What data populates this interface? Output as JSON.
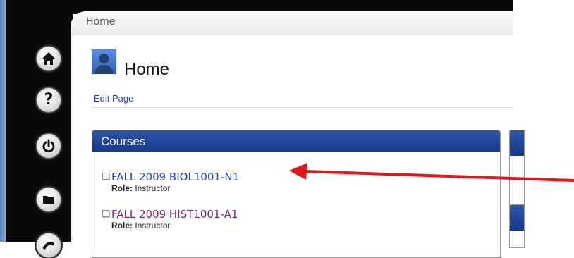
{
  "breadcrumb": {
    "label": "Home"
  },
  "page": {
    "title": "Home",
    "edit_link": "Edit Page"
  },
  "nav": [
    {
      "name": "home",
      "icon": "home-icon",
      "glyph": "⌂"
    },
    {
      "name": "help",
      "icon": "help-icon",
      "glyph": "?"
    },
    {
      "name": "power",
      "icon": "power-icon",
      "glyph": "⏻"
    },
    {
      "name": "folder",
      "icon": "folder-icon",
      "glyph": "▬"
    },
    {
      "name": "globe",
      "icon": "globe-icon",
      "glyph": "◐"
    }
  ],
  "courses": {
    "title": "Courses",
    "items": [
      {
        "name": "FALL 2009 BIOL1001-N1",
        "role_label": "Role:",
        "role": "Instructor",
        "color": "#1d3fb7"
      },
      {
        "name": "FALL 2009 HIST1001-A1",
        "role_label": "Role:",
        "role": "Instructor",
        "color": "#7a1f7a"
      }
    ]
  },
  "colors": {
    "header_blue": "#1f449a",
    "link_blue": "#1d3fb7",
    "visited_purple": "#7a1f7a",
    "arrow_red": "#e0171b"
  }
}
